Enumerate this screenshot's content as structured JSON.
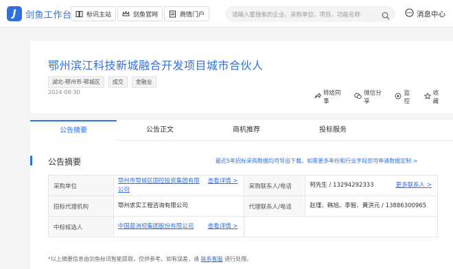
{
  "topbar": {
    "logo_text": "剑鱼工作台",
    "nav": [
      "标讯主站",
      "剑鱼官网",
      "商情门户"
    ],
    "search_placeholder": "请输入要搜索的企业、采购单位、项目、功能名称",
    "message_center": "消息中心"
  },
  "header": {
    "title": "鄂州滨江科技新城融合开发项目城市合伙人",
    "tags": [
      "湖北-鄂州市-鄂城区",
      "成交",
      "金融业"
    ],
    "date": "2024-09-30",
    "actions": [
      "转给同事",
      "微信分享",
      "监控",
      "收藏"
    ]
  },
  "tabs": [
    "公告摘要",
    "公告正文",
    "商机推荐",
    "投标服务"
  ],
  "summary": {
    "title": "公告摘要",
    "export_link": "最近5年招标采购数据均可导出下载，如需更多年份和行业字段您可申请数据定制 >",
    "rows": [
      {
        "label": "采购单位",
        "value": "鄂州市鄂城区国控投资集团有限公司",
        "link": "查看详情 >",
        "label2": "采购联系人/电话",
        "value2": "柯先生 / 13294292333",
        "link2": "更多联系人 >"
      },
      {
        "label": "招标代理机构",
        "value": "鄂州求实工程咨询有限公司",
        "link": "",
        "label2": "代理联系人/电话",
        "value2": "赵瑾、韩旭、李智、黄洪元 / 13886300965",
        "link2": ""
      },
      {
        "label": "中标候选人",
        "value": "中国葛洲坝集团股份有限公司",
        "link": "查看详情 >"
      }
    ],
    "note_prefix": "*以上摘要信息由剑鱼标讯智能提取，仅供参考。如有误差，请",
    "note_link": "联系客服",
    "note_suffix": "进行处理。"
  }
}
